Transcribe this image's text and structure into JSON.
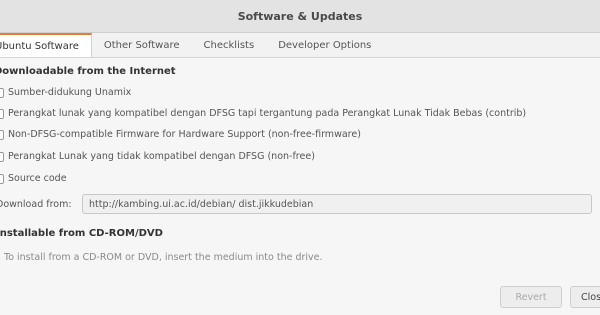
{
  "window": {
    "title": "Software & Updates"
  },
  "tabs": [
    {
      "label": "Ubuntu Software",
      "active": true
    },
    {
      "label": "Other Software",
      "active": false
    },
    {
      "label": "Checklists",
      "active": false
    },
    {
      "label": "Developer Options",
      "active": false
    }
  ],
  "internet_section": {
    "title": "Downloadable from the Internet",
    "items": [
      {
        "label": "Sumber-didukung Unamix",
        "checked": false
      },
      {
        "label": "Perangkat lunak yang kompatibel dengan DFSG tapi tergantung pada Perangkat Lunak Tidak Bebas (contrib)",
        "checked": false
      },
      {
        "label": "Non-DFSG-compatible Firmware for Hardware Support (non-free-firmware)",
        "checked": false
      },
      {
        "label": "Perangkat Lunak yang tidak kompatibel dengan DFSG (non-free)",
        "checked": false
      },
      {
        "label": "Source code",
        "checked": false
      }
    ]
  },
  "download": {
    "label": "Download from:",
    "value": "http://kambing.ui.ac.id/debian/ dist.jikkudebian"
  },
  "cdrom_section": {
    "title": "Installable from CD-ROM/DVD",
    "note": "To install from a CD-ROM or DVD, insert the medium into the drive."
  },
  "buttons": {
    "revert": "Revert",
    "close": "Close"
  }
}
